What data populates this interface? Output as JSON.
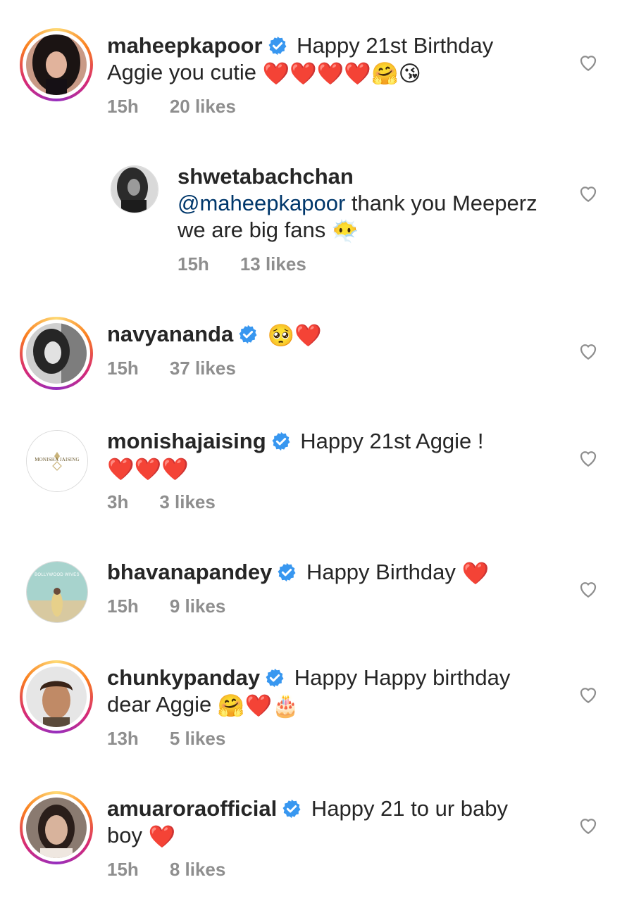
{
  "comments": [
    {
      "username": "maheepkapoor",
      "verified": true,
      "text": "Happy 21st Birthday Aggie you cutie",
      "emojis": "❤️❤️❤️❤️🤗😘",
      "time": "15h",
      "likes": "20 likes",
      "avatar": "woman-dark-hair"
    },
    {
      "username": "shwetabachchan",
      "verified": false,
      "mention": "@maheepkapoor",
      "text": "thank you Meeperz we are big fans",
      "emojis": "😶‍🌫️",
      "time": "15h",
      "likes": "13 likes",
      "avatar": "woman-bw"
    },
    {
      "username": "navyananda",
      "verified": true,
      "text": "",
      "emojis": "🥺❤️",
      "time": "15h",
      "likes": "37 likes",
      "avatar": "woman-bw-smile"
    },
    {
      "username": "monishajaising",
      "verified": true,
      "text": "Happy 21st Aggie !",
      "emojis": "❤️❤️❤️",
      "time": "3h",
      "likes": "3 likes",
      "avatar": "logo",
      "avatar_text": "MONISHA JAISING"
    },
    {
      "username": "bhavanapandey",
      "verified": true,
      "text": "Happy Birthday",
      "emojis": "❤️",
      "time": "15h",
      "likes": "9 likes",
      "avatar": "poster",
      "avatar_text": "BOLLYWOOD WIVES"
    },
    {
      "username": "chunkypanday",
      "verified": true,
      "text": "Happy Happy birthday dear Aggie",
      "emojis": "🤗❤️🎂",
      "time": "13h",
      "likes": "5 likes",
      "avatar": "man"
    },
    {
      "username": "amuaroraofficial",
      "verified": true,
      "text": "Happy 21 to ur baby boy",
      "emojis": "❤️",
      "time": "15h",
      "likes": "8 likes",
      "avatar": "woman"
    }
  ],
  "colors": {
    "verified": "#3897f0",
    "meta": "#8e8e8e",
    "mention": "#00376b",
    "heart": "#e0101c"
  }
}
